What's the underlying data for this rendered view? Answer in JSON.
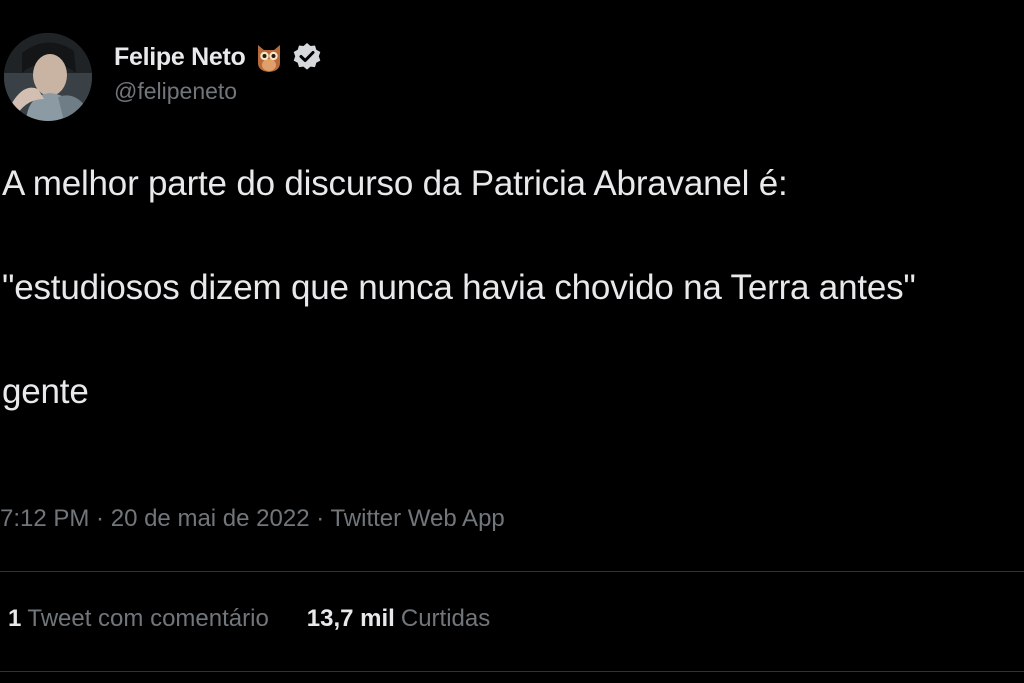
{
  "author": {
    "display_name": "Felipe Neto",
    "handle": "@felipeneto",
    "badge_emoji_icon": "owl-icon",
    "verified_icon": "verified-badge-icon"
  },
  "tweet": {
    "lines": [
      "A melhor parte do discurso da Patricia Abravanel é:",
      "\"estudiosos dizem que nunca havia chovido na Terra antes\"",
      "gente"
    ]
  },
  "meta": {
    "time": "7:12 PM",
    "separator": " · ",
    "date": "20 de mai de 2022",
    "source": "Twitter Web App"
  },
  "stats": {
    "quotes": {
      "count": "1",
      "label": "Tweet com comentário"
    },
    "likes": {
      "count": "13,7 mil",
      "label": "Curtidas"
    }
  },
  "colors": {
    "background": "#000000",
    "primary_text": "#e7e9ea",
    "secondary_text": "#71767b",
    "divider": "#2f3336"
  }
}
